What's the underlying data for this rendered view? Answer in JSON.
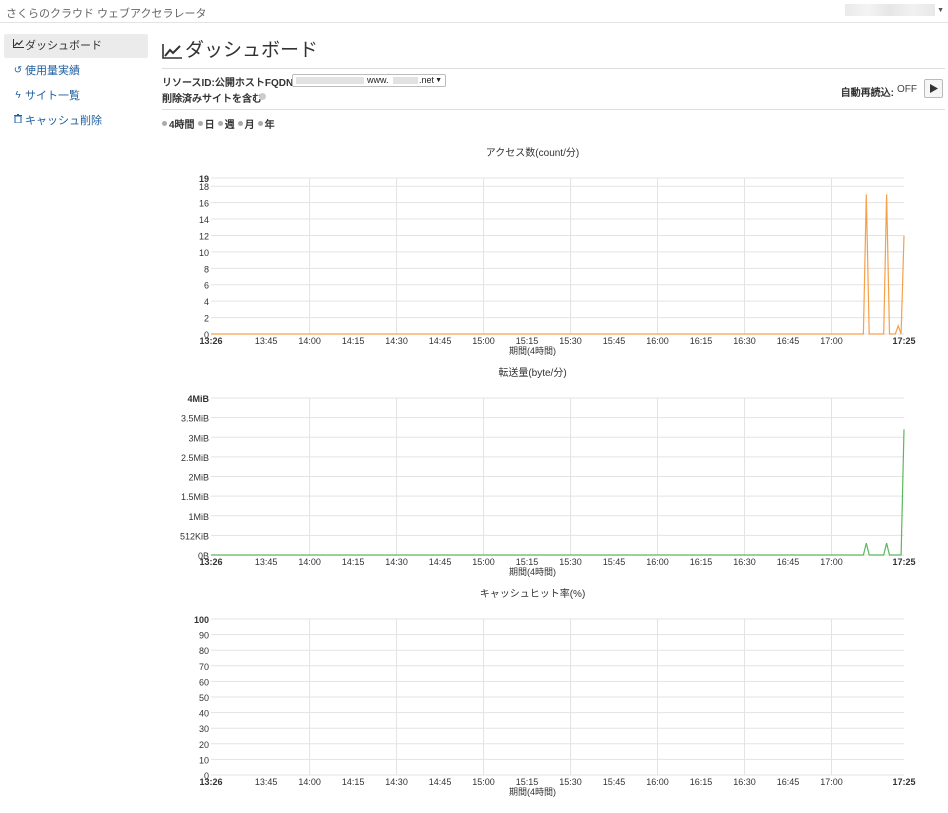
{
  "app": {
    "title": "さくらのクラウド ウェブアクセラレータ"
  },
  "sidebar": {
    "items": [
      {
        "label": "ダッシュボード",
        "icon": "chart-line-icon",
        "active": true
      },
      {
        "label": "使用量実績",
        "icon": "history-icon",
        "active": false
      },
      {
        "label": "サイト一覧",
        "icon": "bolt-icon",
        "active": false
      },
      {
        "label": "キャッシュ削除",
        "icon": "trash-icon",
        "active": false
      }
    ]
  },
  "main": {
    "title": "ダッシュボード",
    "resource_label": "リソースID:公開ホストFQDN",
    "resource_value_prefix": "www.",
    "resource_value_suffix": ".net",
    "include_deleted_label": "削除済みサイトを含む",
    "auto_reload_label": "自動再読込:",
    "auto_reload_state": "OFF",
    "periods": [
      "4時間",
      "日",
      "週",
      "月",
      "年"
    ]
  },
  "colors": {
    "access": "#f5a04a",
    "transfer": "#5cb85c",
    "grid": "#e3e3e3"
  },
  "chart_data": [
    {
      "type": "line",
      "title": "アクセス数(count/分)",
      "xlabel": "期間(4時間)",
      "x_ticks": [
        "13:26",
        "13:45",
        "14:00",
        "14:15",
        "14:30",
        "14:45",
        "15:00",
        "15:15",
        "15:30",
        "15:45",
        "16:00",
        "16:15",
        "16:30",
        "16:45",
        "17:00",
        "17:25"
      ],
      "y_ticks": [
        "0",
        "2",
        "4",
        "6",
        "8",
        "10",
        "12",
        "14",
        "16",
        "18",
        "19"
      ],
      "ylim": [
        0,
        19
      ],
      "x_range_minutes": [
        0,
        239
      ],
      "series": [
        {
          "points": [
            [
              0,
              0
            ],
            [
              225,
              0
            ],
            [
              226,
              17
            ],
            [
              227,
              0
            ],
            [
              231,
              0
            ],
            [
              232,
              0
            ],
            [
              233,
              17
            ],
            [
              234,
              0
            ],
            [
              236,
              0
            ],
            [
              237,
              1
            ],
            [
              238,
              0
            ],
            [
              239,
              12
            ]
          ]
        }
      ]
    },
    {
      "type": "line",
      "title": "転送量(byte/分)",
      "xlabel": "期間(4時間)",
      "x_ticks": [
        "13:26",
        "13:45",
        "14:00",
        "14:15",
        "14:30",
        "14:45",
        "15:00",
        "15:15",
        "15:30",
        "15:45",
        "16:00",
        "16:15",
        "16:30",
        "16:45",
        "17:00",
        "17:25"
      ],
      "y_ticks": [
        "0B",
        "512KiB",
        "1MiB",
        "1.5MiB",
        "2MiB",
        "2.5MiB",
        "3MiB",
        "3.5MiB",
        "4MiB"
      ],
      "y_tick_values": [
        0,
        0.5,
        1,
        1.5,
        2,
        2.5,
        3,
        3.5,
        4
      ],
      "ylim": [
        0,
        4
      ],
      "x_range_minutes": [
        0,
        239
      ],
      "series": [
        {
          "points": [
            [
              0,
              0
            ],
            [
              225,
              0
            ],
            [
              226,
              0.3
            ],
            [
              227,
              0
            ],
            [
              232,
              0
            ],
            [
              233,
              0.3
            ],
            [
              234,
              0
            ],
            [
              238,
              0
            ],
            [
              239,
              3.2
            ]
          ]
        }
      ]
    },
    {
      "type": "line",
      "title": "キャッシュヒット率(%)",
      "xlabel": "期間(4時間)",
      "x_ticks": [
        "13:26",
        "13:45",
        "14:00",
        "14:15",
        "14:30",
        "14:45",
        "15:00",
        "15:15",
        "15:30",
        "15:45",
        "16:00",
        "16:15",
        "16:30",
        "16:45",
        "17:00",
        "17:25"
      ],
      "y_ticks": [
        "0",
        "10",
        "20",
        "30",
        "40",
        "50",
        "60",
        "70",
        "80",
        "90",
        "100"
      ],
      "ylim": [
        0,
        100
      ],
      "x_range_minutes": [
        0,
        239
      ],
      "series": []
    }
  ]
}
